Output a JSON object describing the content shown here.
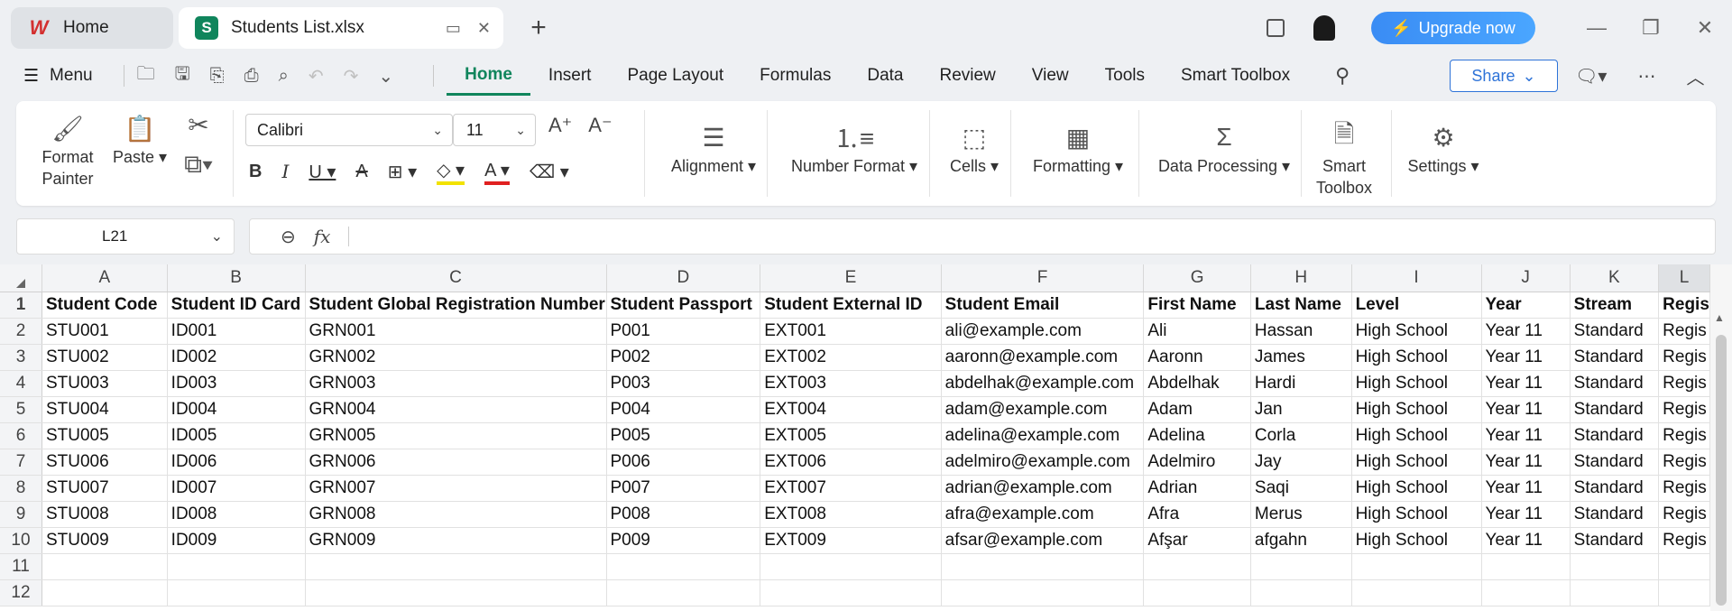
{
  "titlebar": {
    "home_tab": "Home",
    "file_tab": "Students List.xlsx",
    "file_icon_letter": "S",
    "upgrade_label": "Upgrade now"
  },
  "menubar": {
    "menu_label": "Menu",
    "tabs": [
      "Home",
      "Insert",
      "Page Layout",
      "Formulas",
      "Data",
      "Review",
      "View",
      "Tools",
      "Smart Toolbox"
    ],
    "active_tab": "Home",
    "share_label": "Share"
  },
  "ribbon": {
    "format_painter": "Format Painter",
    "paste": "Paste",
    "font_name": "Calibri",
    "font_size": "11",
    "alignment": "Alignment",
    "number_format": "Number Format",
    "cells": "Cells",
    "formatting": "Formatting",
    "data_processing": "Data Processing",
    "smart_toolbox": "Smart Toolbox",
    "settings": "Settings"
  },
  "formula_bar": {
    "name_box": "L21",
    "formula": ""
  },
  "sheet": {
    "columns": [
      "A",
      "B",
      "C",
      "D",
      "E",
      "F",
      "G",
      "H",
      "I",
      "J",
      "K",
      "L"
    ],
    "row_numbers": [
      "1",
      "2",
      "3",
      "4",
      "5",
      "6",
      "7",
      "8",
      "9",
      "10",
      "11",
      "12"
    ],
    "header": [
      "Student Code",
      "Student ID Card",
      "Student Global Registration Number",
      "Student Passport",
      "Student External ID",
      "Student Email",
      "First Name",
      "Last Name",
      "Level",
      "Year",
      "Stream",
      "Regis"
    ],
    "rows": [
      [
        "STU001",
        "ID001",
        "GRN001",
        "P001",
        "EXT001",
        "ali@example.com",
        "Ali",
        "Hassan",
        "High School",
        "Year 11",
        "Standard",
        "Regis"
      ],
      [
        "STU002",
        "ID002",
        "GRN002",
        "P002",
        "EXT002",
        "aaronn@example.com",
        "Aaronn",
        "James",
        "High School",
        "Year 11",
        "Standard",
        "Regis"
      ],
      [
        "STU003",
        "ID003",
        "GRN003",
        "P003",
        "EXT003",
        "abdelhak@example.com",
        "Abdelhak",
        "Hardi",
        "High School",
        "Year 11",
        "Standard",
        "Regis"
      ],
      [
        "STU004",
        "ID004",
        "GRN004",
        "P004",
        "EXT004",
        "adam@example.com",
        "Adam",
        "Jan",
        "High School",
        "Year 11",
        "Standard",
        "Regis"
      ],
      [
        "STU005",
        "ID005",
        "GRN005",
        "P005",
        "EXT005",
        "adelina@example.com",
        "Adelina",
        "Corla",
        "High School",
        "Year 11",
        "Standard",
        "Regis"
      ],
      [
        "STU006",
        "ID006",
        "GRN006",
        "P006",
        "EXT006",
        "adelmiro@example.com",
        "Adelmiro",
        "Jay",
        "High School",
        "Year 11",
        "Standard",
        "Regis"
      ],
      [
        "STU007",
        "ID007",
        "GRN007",
        "P007",
        "EXT007",
        "adrian@example.com",
        "Adrian",
        "Saqi",
        "High School",
        "Year 11",
        "Standard",
        "Regis"
      ],
      [
        "STU008",
        "ID008",
        "GRN008",
        "P008",
        "EXT008",
        "afra@example.com",
        "Afra",
        "Merus",
        "High School",
        "Year 11",
        "Standard",
        "Regis"
      ],
      [
        "STU009",
        "ID009",
        "GRN009",
        "P009",
        "EXT009",
        "afsar@example.com",
        "Afşar",
        "afgahn",
        "High School",
        "Year 11",
        "Standard",
        "Regis"
      ],
      [
        "",
        "",
        "",
        "",
        "",
        "",
        "",
        "",
        "",
        "",
        "",
        ""
      ],
      [
        "",
        "",
        "",
        "",
        "",
        "",
        "",
        "",
        "",
        "",
        "",
        ""
      ]
    ]
  },
  "colors": {
    "accent": "#10855c",
    "share": "#2e73d8",
    "upgrade": "#3a8cf4"
  }
}
